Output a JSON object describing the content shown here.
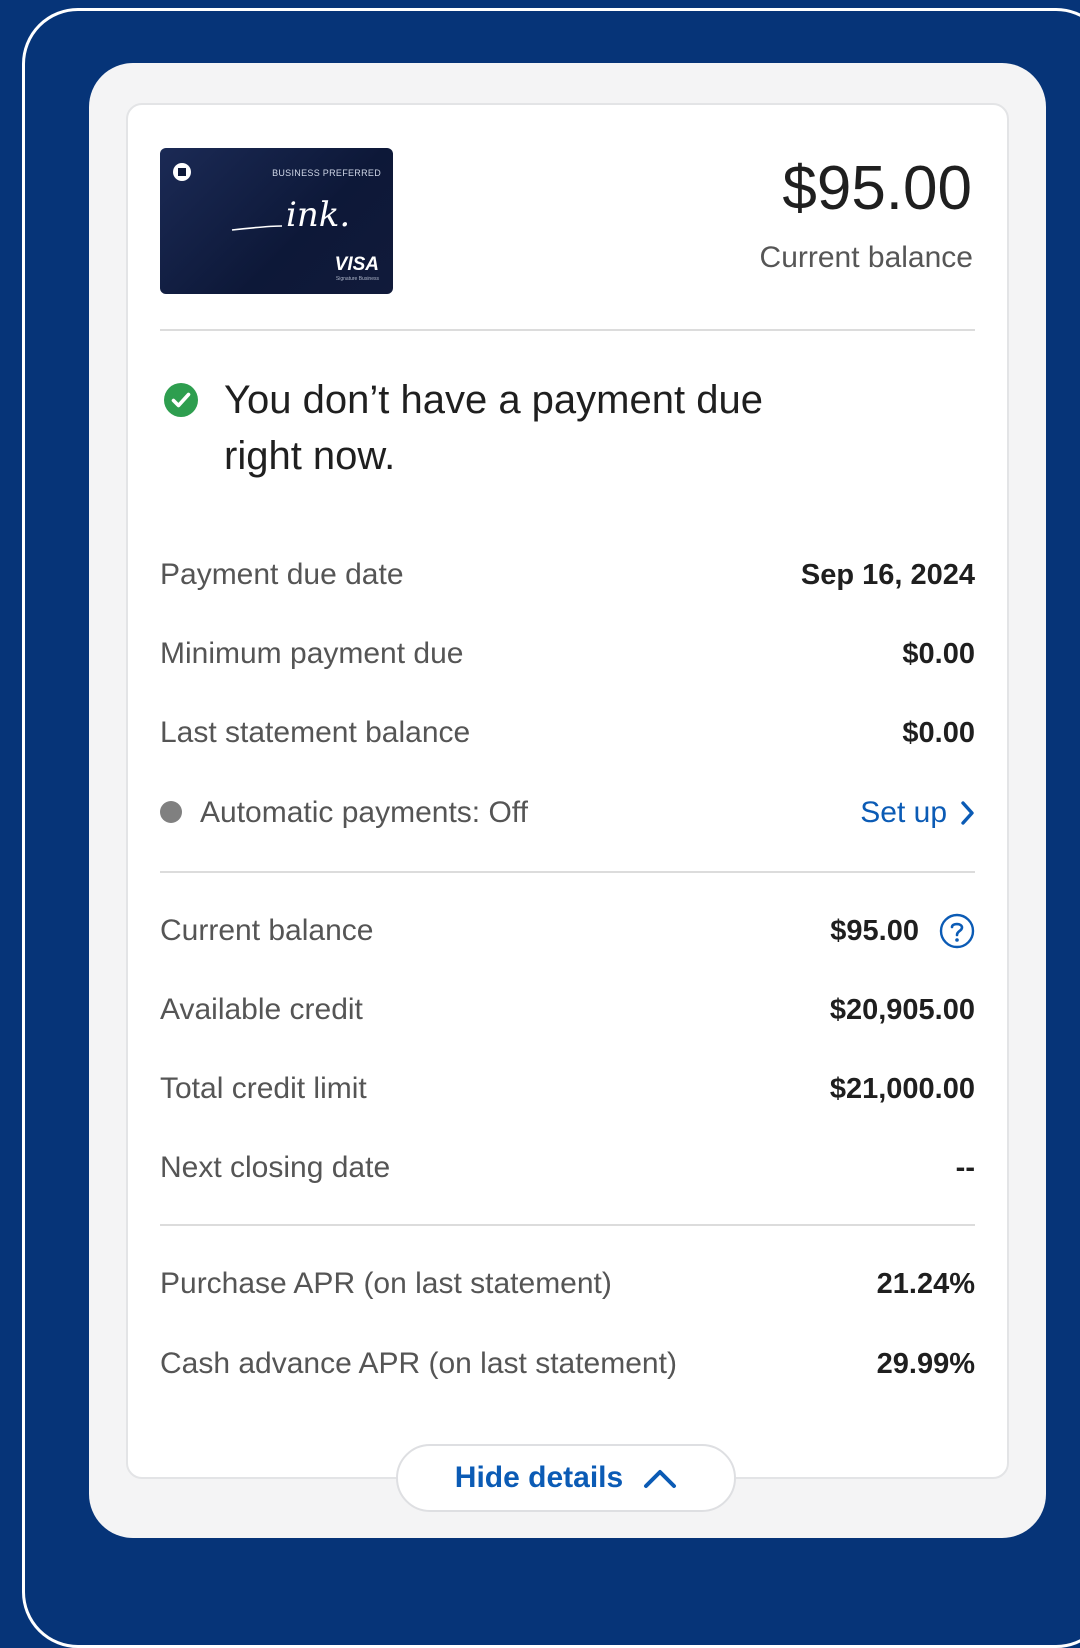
{
  "card": {
    "tier_text": "BUSINESS PREFERRED",
    "brand_wordmark": "ink.",
    "network": "VISA",
    "network_sub": "Signature Business"
  },
  "summary": {
    "balance": "$95.00",
    "balance_label": "Current balance"
  },
  "status": {
    "icon": "check-circle-icon",
    "message": "You don’t have a payment due right now."
  },
  "payment_rows": [
    {
      "label": "Payment due date",
      "value": "Sep 16, 2024"
    },
    {
      "label": "Minimum payment due",
      "value": "$0.00"
    },
    {
      "label": "Last statement balance",
      "value": "$0.00"
    }
  ],
  "autopay": {
    "label": "Automatic payments: Off",
    "action": "Set up",
    "icon": "chevron-right-icon"
  },
  "balance_rows": [
    {
      "label": "Current balance",
      "value": "$95.00",
      "help_icon": "question-circle-icon"
    },
    {
      "label": "Available credit",
      "value": "$20,905.00"
    },
    {
      "label": "Total credit limit",
      "value": "$21,000.00"
    },
    {
      "label": "Next closing date",
      "value": "--"
    }
  ],
  "apr_rows": [
    {
      "label": "Purchase APR (on last statement)",
      "value": "21.24%"
    },
    {
      "label": "Cash advance APR (on last statement)",
      "value": "29.99%"
    }
  ],
  "hide_details": {
    "label": "Hide details",
    "icon": "chevron-up-icon"
  },
  "colors": {
    "background": "#063478",
    "link": "#0b5bb5",
    "success": "#2e9e4f",
    "muted_dot": "#808080"
  }
}
